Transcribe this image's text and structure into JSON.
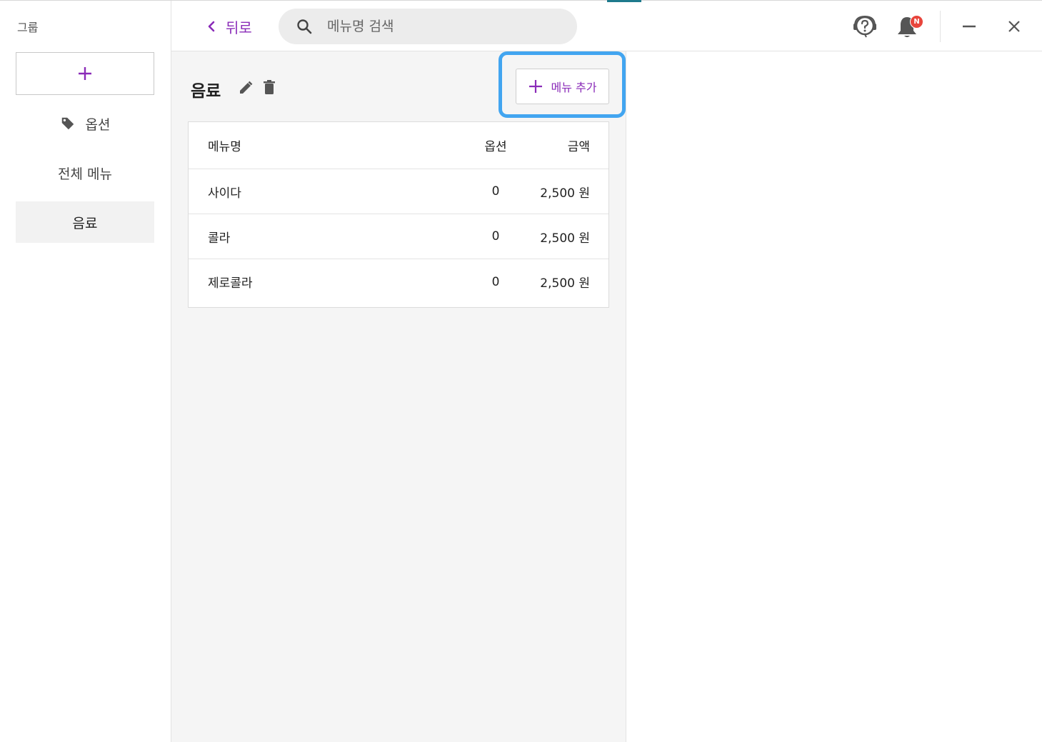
{
  "sidebar": {
    "title": "그룹",
    "items": [
      {
        "label": "옵션",
        "icon": "tag-icon"
      },
      {
        "label": "전체 메뉴"
      },
      {
        "label": "음료",
        "active": true
      }
    ]
  },
  "topbar": {
    "back_label": "뒤로",
    "search_placeholder": "메뉴명 검색",
    "notification_badge": "N"
  },
  "main": {
    "group_title": "음료",
    "add_menu_label": "메뉴 추가",
    "table": {
      "headers": {
        "name": "메뉴명",
        "options": "옵션",
        "price": "금액"
      },
      "rows": [
        {
          "name": "사이다",
          "options": "0",
          "price": "2,500 원"
        },
        {
          "name": "콜라",
          "options": "0",
          "price": "2,500 원"
        },
        {
          "name": "제로콜라",
          "options": "0",
          "price": "2,500 원"
        }
      ]
    }
  },
  "colors": {
    "accent": "#8a2bb8",
    "highlight": "#42a5f0",
    "badge": "#e8453c"
  }
}
